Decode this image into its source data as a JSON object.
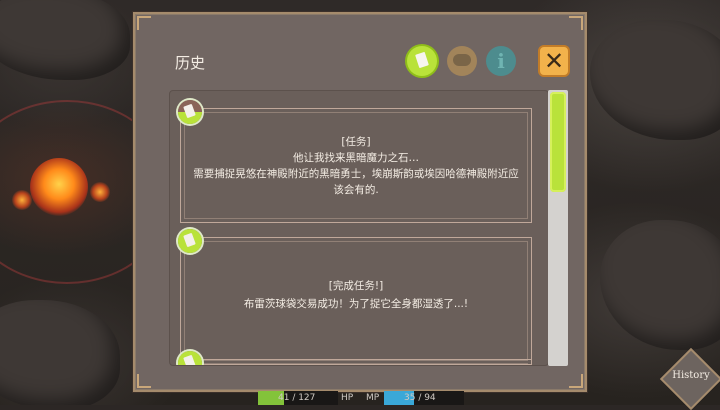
{
  "dialog": {
    "title": "历史",
    "tabs": [
      {
        "icon": "note-icon",
        "active": true
      },
      {
        "icon": "chat-bubble-icon",
        "active": false
      },
      {
        "icon": "info-icon",
        "active": false,
        "glyph": "i"
      }
    ],
    "close_glyph": "✕"
  },
  "entries": [
    {
      "icon": "quest-icon",
      "lines": [
        "[任务]",
        "他让我找来黑暗魔力之石…",
        "需要捕捉晃悠在神殿附近的黑暗勇士，埃崩斯韵或埃因哈德神殿附近应",
        "该会有的."
      ]
    },
    {
      "icon": "quest-complete-icon",
      "lines": [
        "[完成任务!]",
        "布雷茨球袋交易成功！为了捉它全身都湿透了...!"
      ]
    },
    {
      "icon": "quest-complete-icon",
      "lines": []
    }
  ],
  "hud": {
    "hp_value": "41 / 127",
    "hp_label": "HP",
    "hp_fraction": 0.32,
    "mp_label": "MP",
    "mp_value": "35 / 94",
    "mp_fraction": 0.37
  },
  "history_button": "History",
  "colors": {
    "accent_green": "#b9e23a",
    "panel": "#716662",
    "close_button": "#f2b24b"
  }
}
